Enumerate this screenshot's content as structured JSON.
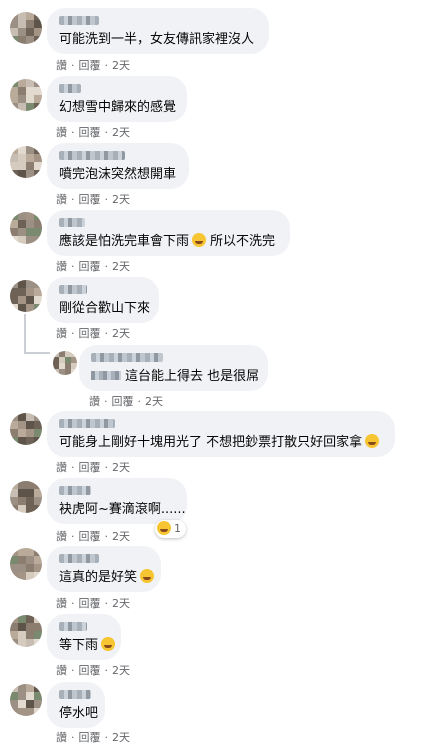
{
  "meta": {
    "like": "讚",
    "dot": "·",
    "reply": "回覆",
    "age": "2天"
  },
  "comments": [
    {
      "text": "可能洗到一半，女友傳訊家裡沒人"
    },
    {
      "text": "幻想雪中歸來的感覺"
    },
    {
      "text": "噴完泡沫突然想開車"
    },
    {
      "text": "應該是怕洗完車會下雨",
      "suffix": "所以不洗完",
      "emoji": "tears-of-joy-emoji"
    },
    {
      "text": "剛從合歡山下來"
    },
    {
      "text": "這台能上得去 也是很屌"
    },
    {
      "text": "可能身上剛好十塊用光了 不想把鈔票打散只好回家拿",
      "emoji": "rolling-laughing-emoji"
    },
    {
      "text": "袂虎阿~賽滴滾啊......",
      "reaction_count": "1",
      "reaction_emoji": "tears-of-joy-emoji"
    },
    {
      "text": "這真的是好笑",
      "emoji": "hands-over-face-emoji"
    },
    {
      "text": "等下雨",
      "emoji": "grin-emoji"
    },
    {
      "text": "停水吧"
    }
  ]
}
